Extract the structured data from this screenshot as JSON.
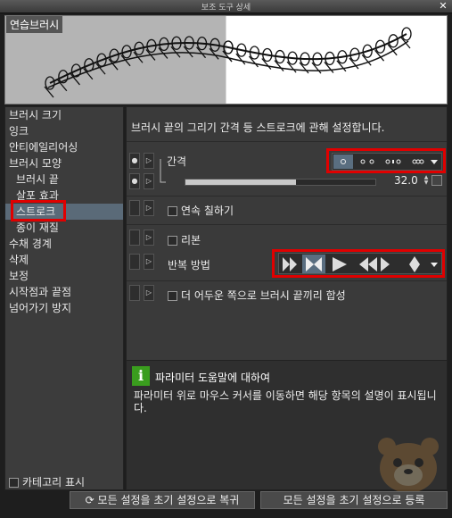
{
  "window": {
    "title": "보조 도구 상세",
    "close_glyph": "✕"
  },
  "preview": {
    "label": "연습브러시"
  },
  "sidebar": {
    "items": [
      {
        "label": "브러시 크기"
      },
      {
        "label": "잉크"
      },
      {
        "label": "안티에일리어싱"
      },
      {
        "label": "브러시 모양"
      },
      {
        "label": "브러시 끝"
      },
      {
        "label": "살포 효과"
      },
      {
        "label": "스트로크"
      },
      {
        "label": "종이 재질"
      },
      {
        "label": "수채 경계"
      },
      {
        "label": "삭제"
      },
      {
        "label": "보정"
      },
      {
        "label": "시작점과 끝점"
      },
      {
        "label": "넘어가기 방지"
      }
    ],
    "category_toggle": "카테고리 표시"
  },
  "main": {
    "description": "브러시 끝의 그리기 간격 등 스트로크에 관해 설정합니다.",
    "spacing": {
      "label": "간격",
      "value": "32.0",
      "slider_fraction": 0.58
    },
    "continuous": {
      "label": "연속 칠하기"
    },
    "ribbon": {
      "label": "리본"
    },
    "repeat": {
      "label": "반복 방법"
    },
    "merge": {
      "label": "더 어두운 쪽으로 브러시 끝끼리 합성"
    }
  },
  "help": {
    "title": "파라미터 도움말에 대하여",
    "body": "파라미터 위로 마우스 커서를 이동하면 해당 항목의 설명이 표시됩니다.",
    "icon": "info-icon"
  },
  "footer": {
    "reset_button": "모든 설정을 초기 설정으로 복귀",
    "register_button": "모든 설정을 초기 설정으로 등록"
  },
  "colors": {
    "highlight": "#e00000",
    "info_icon": "#3a9d1e"
  }
}
